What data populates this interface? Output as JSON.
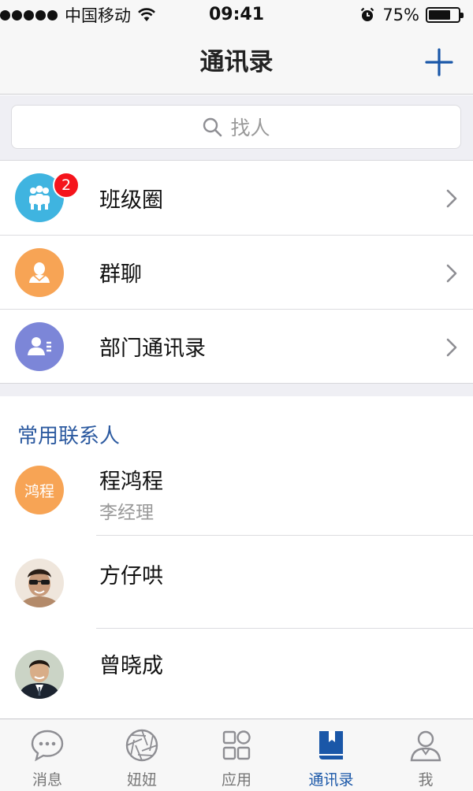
{
  "status_bar": {
    "carrier": "中国移动",
    "time": "09:41",
    "battery": "75%",
    "battery_level": 0.75,
    "icons": [
      "signal-dots-icon",
      "wifi-icon",
      "alarm-icon",
      "battery-icon"
    ]
  },
  "nav": {
    "title": "通讯录",
    "add_icon": "plus-icon"
  },
  "search": {
    "placeholder": "找人",
    "icon": "search-icon"
  },
  "menu": [
    {
      "label": "班级圈",
      "icon": "class-circle-icon",
      "color": "#3fb4e0",
      "badge": "2"
    },
    {
      "label": "群聊",
      "icon": "group-chat-icon",
      "color": "#f7a455"
    },
    {
      "label": "部门通讯录",
      "icon": "department-directory-icon",
      "color": "#7c86d8"
    }
  ],
  "contacts": {
    "section_title": "常用联系人",
    "items": [
      {
        "name": "程鸿程",
        "title": "李经理",
        "avatar_text": "鸿程",
        "avatar_color": "#f7a455"
      },
      {
        "name": "方仔哄",
        "avatar": "photo"
      },
      {
        "name": "曾晓成",
        "avatar": "photo"
      }
    ]
  },
  "tabs": [
    {
      "label": "消息",
      "icon": "chat-bubble-icon",
      "active": false
    },
    {
      "label": "妞妞",
      "icon": "camera-aperture-icon",
      "active": false
    },
    {
      "label": "应用",
      "icon": "apps-grid-icon",
      "active": false
    },
    {
      "label": "通讯录",
      "icon": "contacts-book-icon",
      "active": true
    },
    {
      "label": "我",
      "icon": "profile-icon",
      "active": false
    }
  ],
  "colors": {
    "accent": "#1a57a8",
    "section_header": "#2c5aa0",
    "badge": "#f5141c",
    "background": "#efeff4"
  }
}
